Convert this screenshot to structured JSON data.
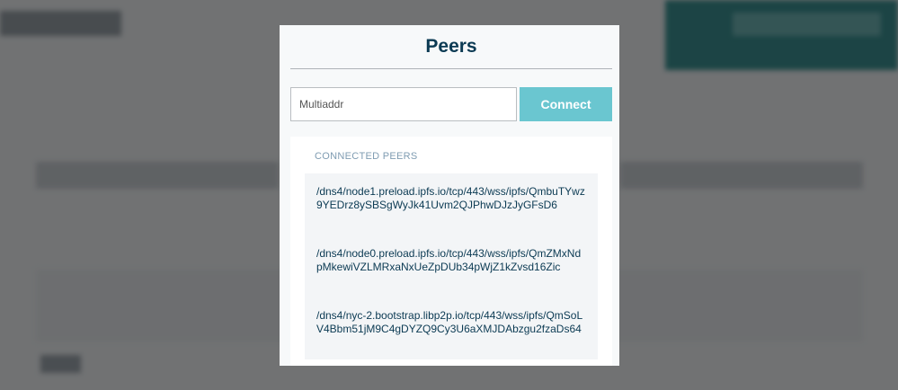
{
  "modal": {
    "title": "Peers",
    "multiaddr_placeholder": "Multiaddr",
    "connect_label": "Connect",
    "section_header": "CONNECTED PEERS",
    "peers": [
      "/dns4/node1.preload.ipfs.io/tcp/443/wss/ipfs/QmbuTYwz9YEDrz8ySBSgWyJk41Uvm2QJPhwDJzJyGFsD6",
      "/dns4/node0.preload.ipfs.io/tcp/443/wss/ipfs/QmZMxNdpMkewiVZLMRxaNxUeZpDUb34pWjZ1kZvsd16Zic",
      "/dns4/nyc-2.bootstrap.libp2p.io/tcp/443/wss/ipfs/QmSoLV4Bbm51jM9C4gDYZQ9Cy3U6aXMJDAbzgu2fzaDs64"
    ]
  },
  "colors": {
    "title": "#0b3a53",
    "connect_button": "#6ac6d0",
    "section_header": "#7f9cb2"
  }
}
